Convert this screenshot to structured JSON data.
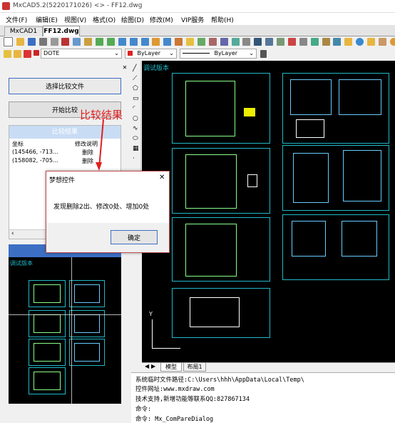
{
  "window": {
    "title": "MxCAD5.2(5220171026) <> - FF12.dwg"
  },
  "menu": [
    "文件(F)",
    "编辑(E)",
    "视图(V)",
    "格式(O)",
    "绘图(D)",
    "修改(M)",
    "VIP服务",
    "帮助(H)"
  ],
  "doc_tabs": [
    {
      "label": "MxCAD1"
    },
    {
      "label": "FF12.dwg"
    }
  ],
  "layer_bar": {
    "layer_value": "DOTE",
    "color_value": "ByLayer",
    "linetype_value": "ByLayer"
  },
  "left_panel": {
    "select_button": "选择比较文件",
    "start_button": "开始比较",
    "results_header": "比较结果",
    "columns": [
      "坐标",
      "修改说明"
    ],
    "rows": [
      {
        "coord": "(145466, -713...",
        "action": "删除"
      },
      {
        "coord": "(158082, -705...",
        "action": "删除"
      }
    ],
    "preview_label": "调试版本"
  },
  "annotation": {
    "text": "比较结果",
    "color": "#e02020"
  },
  "dialog": {
    "title": "梦想控件",
    "message": "发现删除2出、修改0处、增加0处",
    "ok_label": "确定",
    "close_glyph": "✕"
  },
  "canvas": {
    "label": "调试版本",
    "background": "#000000",
    "frame_color": "#1fb8c8"
  },
  "layout_tabs": [
    {
      "label": "模型"
    },
    {
      "label": "布局1"
    }
  ],
  "command_lines": [
    "系统临时文件路径:C:\\Users\\hhh\\AppData\\Local\\Temp\\",
    "控件网址:www.mxdraw.com",
    "技术支持,新增功能等联系QQ:827867134",
    "命令:",
    "命令: Mx_ComPareDialog"
  ],
  "colors": {
    "accent_blue": "#3c6fc4",
    "title_bar": "#ffffff",
    "cad_background": "#000000",
    "cad_cyan": "#1fb8c8"
  }
}
